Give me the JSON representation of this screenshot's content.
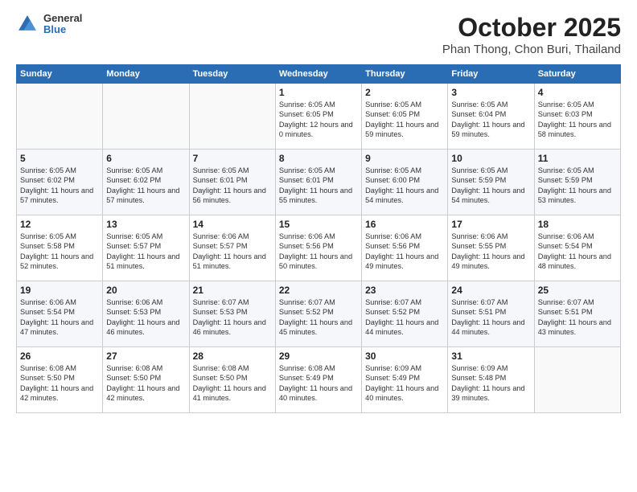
{
  "logo": {
    "general": "General",
    "blue": "Blue"
  },
  "header": {
    "month": "October 2025",
    "location": "Phan Thong, Chon Buri, Thailand"
  },
  "weekdays": [
    "Sunday",
    "Monday",
    "Tuesday",
    "Wednesday",
    "Thursday",
    "Friday",
    "Saturday"
  ],
  "weeks": [
    [
      {
        "day": "",
        "info": ""
      },
      {
        "day": "",
        "info": ""
      },
      {
        "day": "",
        "info": ""
      },
      {
        "day": "1",
        "info": "Sunrise: 6:05 AM\nSunset: 6:05 PM\nDaylight: 12 hours\nand 0 minutes."
      },
      {
        "day": "2",
        "info": "Sunrise: 6:05 AM\nSunset: 6:05 PM\nDaylight: 11 hours\nand 59 minutes."
      },
      {
        "day": "3",
        "info": "Sunrise: 6:05 AM\nSunset: 6:04 PM\nDaylight: 11 hours\nand 59 minutes."
      },
      {
        "day": "4",
        "info": "Sunrise: 6:05 AM\nSunset: 6:03 PM\nDaylight: 11 hours\nand 58 minutes."
      }
    ],
    [
      {
        "day": "5",
        "info": "Sunrise: 6:05 AM\nSunset: 6:02 PM\nDaylight: 11 hours\nand 57 minutes."
      },
      {
        "day": "6",
        "info": "Sunrise: 6:05 AM\nSunset: 6:02 PM\nDaylight: 11 hours\nand 57 minutes."
      },
      {
        "day": "7",
        "info": "Sunrise: 6:05 AM\nSunset: 6:01 PM\nDaylight: 11 hours\nand 56 minutes."
      },
      {
        "day": "8",
        "info": "Sunrise: 6:05 AM\nSunset: 6:01 PM\nDaylight: 11 hours\nand 55 minutes."
      },
      {
        "day": "9",
        "info": "Sunrise: 6:05 AM\nSunset: 6:00 PM\nDaylight: 11 hours\nand 54 minutes."
      },
      {
        "day": "10",
        "info": "Sunrise: 6:05 AM\nSunset: 5:59 PM\nDaylight: 11 hours\nand 54 minutes."
      },
      {
        "day": "11",
        "info": "Sunrise: 6:05 AM\nSunset: 5:59 PM\nDaylight: 11 hours\nand 53 minutes."
      }
    ],
    [
      {
        "day": "12",
        "info": "Sunrise: 6:05 AM\nSunset: 5:58 PM\nDaylight: 11 hours\nand 52 minutes."
      },
      {
        "day": "13",
        "info": "Sunrise: 6:05 AM\nSunset: 5:57 PM\nDaylight: 11 hours\nand 51 minutes."
      },
      {
        "day": "14",
        "info": "Sunrise: 6:06 AM\nSunset: 5:57 PM\nDaylight: 11 hours\nand 51 minutes."
      },
      {
        "day": "15",
        "info": "Sunrise: 6:06 AM\nSunset: 5:56 PM\nDaylight: 11 hours\nand 50 minutes."
      },
      {
        "day": "16",
        "info": "Sunrise: 6:06 AM\nSunset: 5:56 PM\nDaylight: 11 hours\nand 49 minutes."
      },
      {
        "day": "17",
        "info": "Sunrise: 6:06 AM\nSunset: 5:55 PM\nDaylight: 11 hours\nand 49 minutes."
      },
      {
        "day": "18",
        "info": "Sunrise: 6:06 AM\nSunset: 5:54 PM\nDaylight: 11 hours\nand 48 minutes."
      }
    ],
    [
      {
        "day": "19",
        "info": "Sunrise: 6:06 AM\nSunset: 5:54 PM\nDaylight: 11 hours\nand 47 minutes."
      },
      {
        "day": "20",
        "info": "Sunrise: 6:06 AM\nSunset: 5:53 PM\nDaylight: 11 hours\nand 46 minutes."
      },
      {
        "day": "21",
        "info": "Sunrise: 6:07 AM\nSunset: 5:53 PM\nDaylight: 11 hours\nand 46 minutes."
      },
      {
        "day": "22",
        "info": "Sunrise: 6:07 AM\nSunset: 5:52 PM\nDaylight: 11 hours\nand 45 minutes."
      },
      {
        "day": "23",
        "info": "Sunrise: 6:07 AM\nSunset: 5:52 PM\nDaylight: 11 hours\nand 44 minutes."
      },
      {
        "day": "24",
        "info": "Sunrise: 6:07 AM\nSunset: 5:51 PM\nDaylight: 11 hours\nand 44 minutes."
      },
      {
        "day": "25",
        "info": "Sunrise: 6:07 AM\nSunset: 5:51 PM\nDaylight: 11 hours\nand 43 minutes."
      }
    ],
    [
      {
        "day": "26",
        "info": "Sunrise: 6:08 AM\nSunset: 5:50 PM\nDaylight: 11 hours\nand 42 minutes."
      },
      {
        "day": "27",
        "info": "Sunrise: 6:08 AM\nSunset: 5:50 PM\nDaylight: 11 hours\nand 42 minutes."
      },
      {
        "day": "28",
        "info": "Sunrise: 6:08 AM\nSunset: 5:50 PM\nDaylight: 11 hours\nand 41 minutes."
      },
      {
        "day": "29",
        "info": "Sunrise: 6:08 AM\nSunset: 5:49 PM\nDaylight: 11 hours\nand 40 minutes."
      },
      {
        "day": "30",
        "info": "Sunrise: 6:09 AM\nSunset: 5:49 PM\nDaylight: 11 hours\nand 40 minutes."
      },
      {
        "day": "31",
        "info": "Sunrise: 6:09 AM\nSunset: 5:48 PM\nDaylight: 11 hours\nand 39 minutes."
      },
      {
        "day": "",
        "info": ""
      }
    ]
  ]
}
